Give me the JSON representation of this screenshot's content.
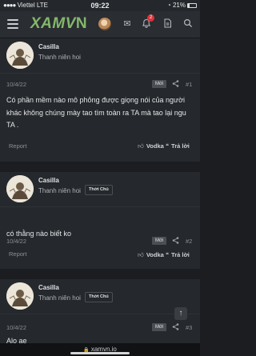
{
  "status_bar": {
    "carrier": "Viettel",
    "network": "LTE",
    "time": "09:22",
    "battery": "21%"
  },
  "app_bar": {
    "logo_left": "XAMV",
    "logo_right": "N",
    "notification_count": "2"
  },
  "posts": [
    {
      "username": "Casilla",
      "user_title": "Thanh niên hoi",
      "op_badge": "",
      "date": "10/4/22",
      "new_label": "Mới",
      "number": "#1",
      "content": "Có phần mềm nào mô phỏng được giọng nói của người khác không chúng mày tao tìm toàn ra TA mà tao lại ngu TA .",
      "report": "Report",
      "like_label": "Vodka",
      "reply_label": "Trả lời"
    },
    {
      "username": "Casilla",
      "user_title": "Thanh niên hoi",
      "op_badge": "Thớt Chủ",
      "date": "10/4/22",
      "new_label": "Mới",
      "number": "#2",
      "content": "có thằng nào biết ko",
      "report": "Report",
      "like_label": "Vodka",
      "reply_label": "Trả lời"
    },
    {
      "username": "Casilla",
      "user_title": "Thanh niên hoi",
      "op_badge": "Thớt Chủ",
      "date": "10/4/22",
      "new_label": "Mới",
      "number": "#3",
      "content": "Alo ae"
    }
  ],
  "url_bar": {
    "lock": "🔒",
    "domain": "xamvn.io"
  },
  "icons": [
    "hamburger-icon",
    "envelope-icon",
    "bell-icon",
    "document-icon",
    "search-icon",
    "share-icon",
    "thumbs-up-icon",
    "reply-icon",
    "arrow-up-icon",
    "lock-icon"
  ],
  "colors": {
    "background": "#1b1d20",
    "card": "#25282c",
    "logo_green": "#84b86c",
    "badge_red": "#d9363e"
  }
}
